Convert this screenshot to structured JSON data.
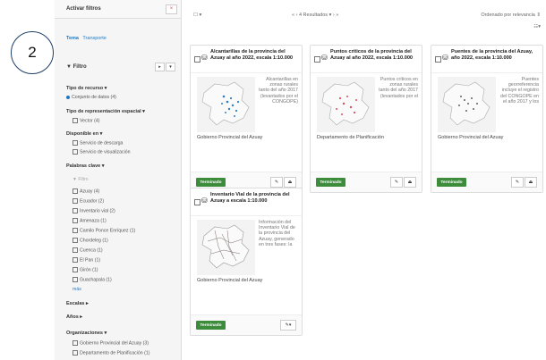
{
  "sidebar": {
    "title": "Activar filtros",
    "close": "×",
    "tabs": [
      "Tema",
      "Transporte"
    ],
    "filter_header": "Filtro",
    "filter_buttons": [
      "▸",
      "▾"
    ],
    "sections": {
      "recurso": "Tipo de recurso ▾",
      "recurso_opt": "Conjunto de datos (4)",
      "representacion": "Tipo de representación espacial ▾",
      "representacion_opt": "Vector (4)",
      "disponible": "Disponible en ▾",
      "disponible_opts": [
        "Servicio de descarga",
        "Servicio de visualización"
      ],
      "palabras": "Palabras clave ▾",
      "filtro_placeholder": "Filtro",
      "palabras_opts": [
        "Azuay (4)",
        "Ecuador (2)",
        "Inventario vial (2)",
        "Amenaza (1)",
        "Camilo Ponce Enríquez (1)",
        "Chordeleg (1)",
        "Cuenca (1)",
        "El Pan (1)",
        "Girón (1)",
        "Guachapala (1)"
      ],
      "mas": "más",
      "escalas": "Escalas ▸",
      "anos": "Años ▸",
      "organizaciones": "Organizaciones ▾",
      "org_opts": [
        "Gobierno Provincial del Azuay (3)",
        "Departamento de Planificación (1)"
      ]
    }
  },
  "annotation": "2",
  "topbar": {
    "select": "☐ ▾",
    "pager": "«   ‹   4 Resultados ▾   ›   »",
    "order": "Ordenado por relevancia ⇕",
    "grid_icon": "☷▾"
  },
  "cards": [
    {
      "title": "Alcantarillas de la provincia del Azuay al año 2022, escala 1:10.000",
      "description": "Alcantarillas en zonas rurales tanto del año 2017 (levantados por el CONGOPE)",
      "organization": "Gobierno Provincial del Azuay",
      "status": "Terminado",
      "actions": [
        "✎",
        "⏏"
      ]
    },
    {
      "title": "Puntos críticos de la provincia del Azuay al año 2022, escala 1:10.000",
      "description": "Puntos críticos en zonas rurales tanto del año 2017 (levantados por el",
      "organization": "Departamento de Planificación",
      "status": "Terminado",
      "actions": [
        "✎",
        "⏏"
      ]
    },
    {
      "title": "Puentes de la provincia del Azuay, año 2022, escala 1:10.000",
      "description": "Puentes georreferencia incluye el registro del CONGOPE en el año 2017 y los",
      "organization": "Gobierno Provincial del Azuay",
      "status": "Terminado",
      "actions": [
        "✎",
        "⏏"
      ]
    },
    {
      "title": "Inventario Vial de la provincia del Azuay a escala 1:10.000",
      "description": "Información del Inventario Vial de la provincia del Azuay, generado en tres fases: la",
      "organization": "Gobierno Provincial del Azuay",
      "status": "Terminado",
      "actions": [
        "✎▾"
      ]
    }
  ],
  "colors": {
    "accent": "#1e78c2",
    "status_green": "#3c8c3c"
  }
}
